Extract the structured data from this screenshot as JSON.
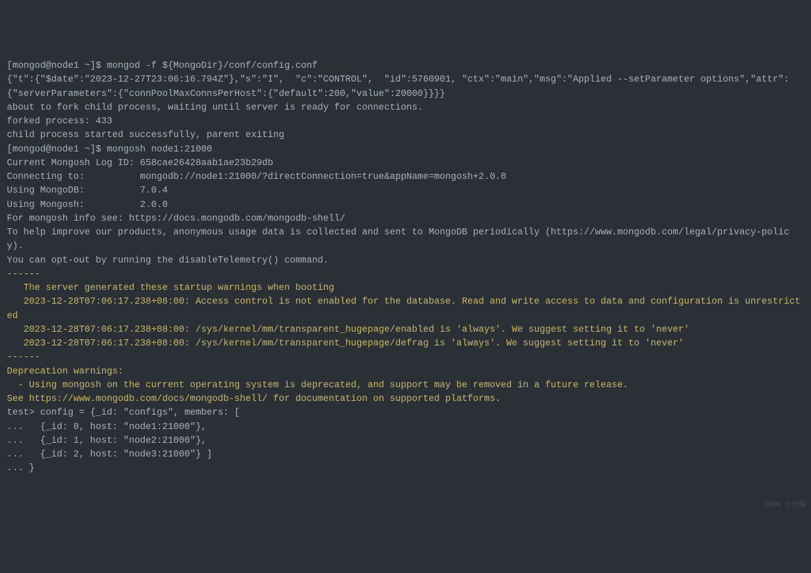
{
  "lines": {
    "l1_prompt": "[mongod@node1 ~]$ ",
    "l1_cmd": "mongod -f ${MongoDir}/conf/config.conf",
    "l2": "{\"t\":{\"$date\":\"2023-12-27T23:06:16.794Z\"},\"s\":\"I\",  \"c\":\"CONTROL\",  \"id\":5760901, \"ctx\":\"main\",\"msg\":\"Applied --setParameter options\",\"attr\":{\"serverParameters\":{\"connPoolMaxConnsPerHost\":{\"default\":200,\"value\":20000}}}}",
    "l3": "about to fork child process, waiting until server is ready for connections.",
    "l4": "forked process: 433",
    "l5": "child process started successfully, parent exiting",
    "l6_prompt": "[mongod@node1 ~]$ ",
    "l6_cmd": "mongosh node1:21000",
    "l7": "Current Mongosh Log ID: 658cae26428aab1ae23b29db",
    "l8": "Connecting to:          mongodb://node1:21000/?directConnection=true&appName=mongosh+2.0.0",
    "l9": "Using MongoDB:          7.0.4",
    "l10": "Using Mongosh:          2.0.0",
    "l11": "",
    "l12": "For mongosh info see: https://docs.mongodb.com/mongodb-shell/",
    "l13": "",
    "l14": "",
    "l15": "To help improve our products, anonymous usage data is collected and sent to MongoDB periodically (https://www.mongodb.com/legal/privacy-policy).",
    "l16": "You can opt-out by running the disableTelemetry() command.",
    "l17": "",
    "l18": "------",
    "l19": "   The server generated these startup warnings when booting",
    "l20": "   2023-12-28T07:06:17.238+08:00: Access control is not enabled for the database. Read and write access to data and configuration is unrestricted",
    "l21": "   2023-12-28T07:06:17.238+08:00: /sys/kernel/mm/transparent_hugepage/enabled is 'always'. We suggest setting it to 'never'",
    "l22": "   2023-12-28T07:06:17.238+08:00: /sys/kernel/mm/transparent_hugepage/defrag is 'always'. We suggest setting it to 'never'",
    "l23": "------",
    "l24": "",
    "l25": "",
    "l26": "Deprecation warnings:",
    "l27": "  - Using mongosh on the current operating system is deprecated, and support may be removed in a future release.",
    "l28": "See https://www.mongodb.com/docs/mongodb-shell/ for documentation on supported platforms.",
    "l29_prompt": "test> ",
    "l29_cmd": "config = {_id: \"configs\", members: [",
    "l30_prompt": "... ",
    "l30_cmd": "  {_id: 0, host: \"node1:21000\"},",
    "l31_prompt": "... ",
    "l31_cmd": "  {_id: 1, host: \"node2:21000\"},",
    "l32_prompt": "... ",
    "l32_cmd": "  {_id: 2, host: \"node3:21000\"} ]",
    "l33_prompt": "... ",
    "l33_cmd": "}",
    "watermark": "CSDN 小仔殇"
  }
}
